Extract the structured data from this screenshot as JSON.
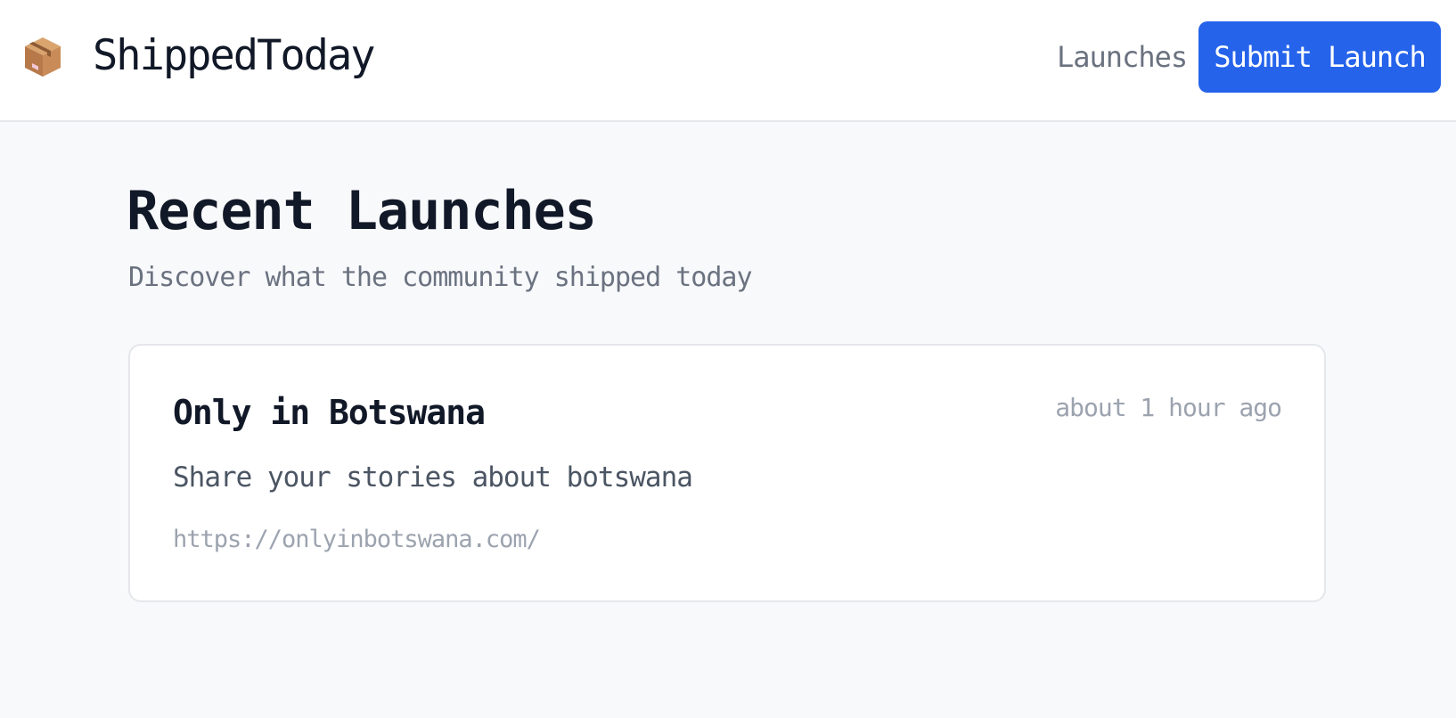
{
  "header": {
    "logo_icon": "package-box-icon",
    "brand": "ShippedToday",
    "nav": {
      "launches_label": "Launches",
      "submit_label": "Submit Launch"
    }
  },
  "main": {
    "title": "Recent Launches",
    "subtitle": "Discover what the community shipped today",
    "launches": [
      {
        "name": "Only in Botswana",
        "time": "about 1 hour ago",
        "description": "Share your stories about botswana",
        "url": "https://onlyinbotswana.com/"
      }
    ]
  },
  "colors": {
    "accent": "#2563eb",
    "background": "#f8f9fb",
    "card": "#ffffff",
    "text": "#111827",
    "muted": "#6b7280"
  }
}
